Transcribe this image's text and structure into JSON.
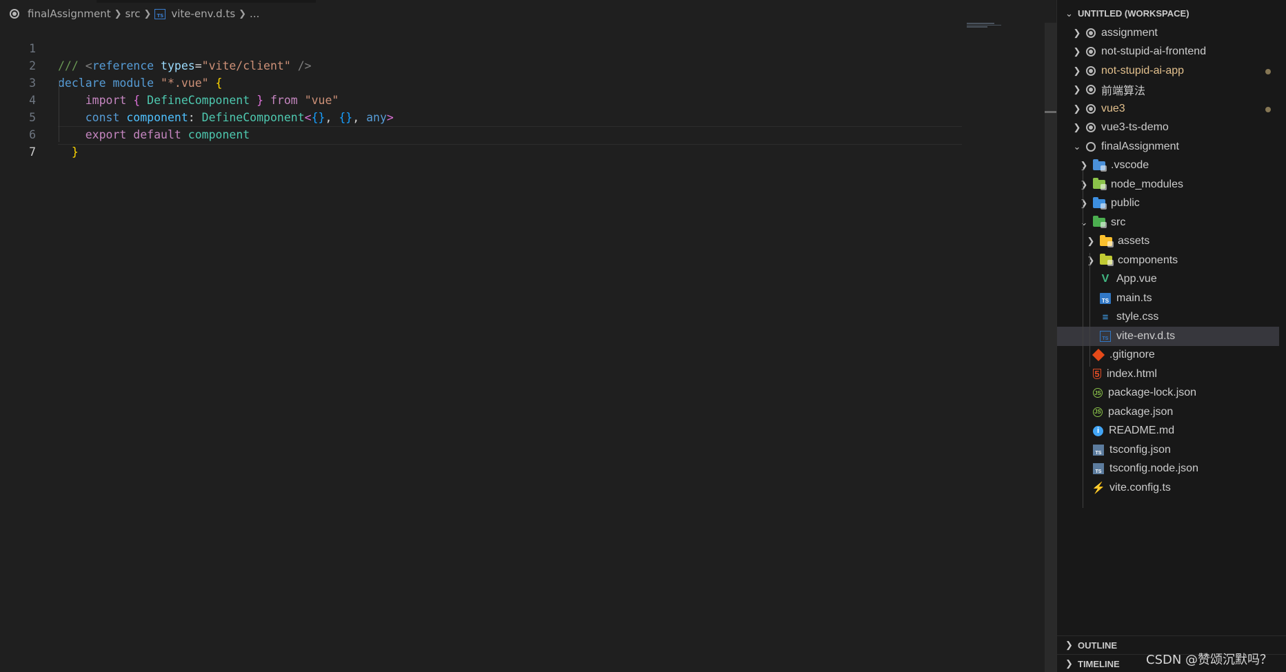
{
  "breadcrumb": {
    "root": "finalAssignment",
    "folder": "src",
    "file": "vite-env.d.ts",
    "ellipsis": "..."
  },
  "code": {
    "line_numbers": [
      "1",
      "2",
      "3",
      "4",
      "5",
      "6",
      "7"
    ],
    "current_line": 7,
    "l1": {
      "comment": "///",
      "tag_open": "<",
      "tag_name": "reference",
      "attr": "types",
      "eq": "=",
      "value": "\"vite/client\"",
      "tag_close": "/>"
    },
    "l2": {
      "kw1": "declare",
      "kw2": "module",
      "str": "\"*.vue\"",
      "brace": "{"
    },
    "l3": {
      "kw": "import",
      "ob": "{",
      "name": "DefineComponent",
      "cb": "}",
      "from": "from",
      "str": "\"vue\""
    },
    "l4": {
      "kw": "const",
      "name": "component",
      "colon": ":",
      "type": "DefineComponent",
      "lt": "<",
      "b1": "{}",
      "comma1": ",",
      "b2": "{}",
      "comma2": ",",
      "any": "any",
      "gt": ">"
    },
    "l5": {
      "kw1": "export",
      "kw2": "default",
      "name": "component"
    },
    "l6": {
      "brace": "}"
    }
  },
  "explorer": {
    "workspace_title": "UNTITLED (WORKSPACE)",
    "roots": [
      {
        "name": "assignment",
        "modified": false
      },
      {
        "name": "not-stupid-ai-frontend",
        "modified": false
      },
      {
        "name": "not-stupid-ai-app",
        "modified": true
      },
      {
        "name": "前端算法",
        "modified": false
      },
      {
        "name": "vue3",
        "modified": true
      },
      {
        "name": "vue3-ts-demo",
        "modified": false
      },
      {
        "name": "finalAssignment",
        "modified": false
      }
    ],
    "final": {
      "folders": [
        ".vscode",
        "node_modules",
        "public",
        "src"
      ],
      "src_children": [
        "assets",
        "components",
        "App.vue",
        "main.ts",
        "style.css",
        "vite-env.d.ts"
      ],
      "files": [
        ".gitignore",
        "index.html",
        "package-lock.json",
        "package.json",
        "README.md",
        "tsconfig.json",
        "tsconfig.node.json",
        "vite.config.ts"
      ]
    },
    "outline_title": "OUTLINE",
    "timeline_title": "TIMELINE"
  },
  "colors": {
    "editor_bg": "#1f1f1f",
    "sidebar_bg": "#181818",
    "selected_row": "#37373d",
    "modified_text": "#e2c08d"
  },
  "watermark": "CSDN @赞颂沉默吗？"
}
